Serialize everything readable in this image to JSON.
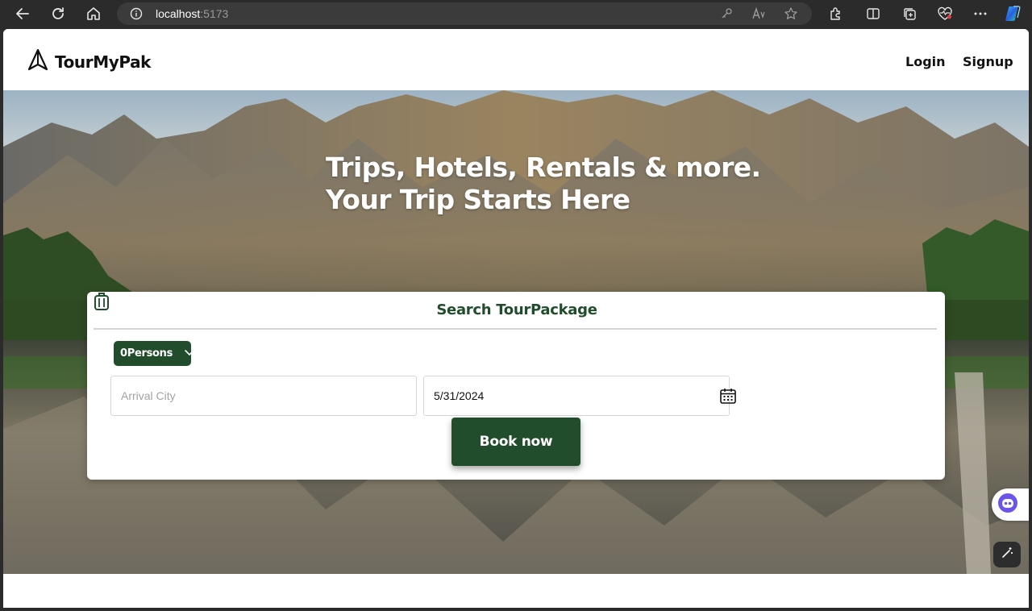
{
  "browser": {
    "url_host": "localhost",
    "url_port": ":5173"
  },
  "navbar": {
    "brand": "TourMyPak",
    "login_label": "Login",
    "signup_label": "Signup"
  },
  "hero": {
    "title_line1": "Trips, Hotels, Rentals & more.",
    "title_line2": "Your Trip Starts Here"
  },
  "search": {
    "title": "Search TourPackage",
    "persons_label": "0Persons",
    "arrival_placeholder": "Arrival City",
    "date_value": "5/31/2024",
    "book_label": "Book now"
  },
  "colors": {
    "brand_green": "#214d2c",
    "browser_bg": "#2b2b2b"
  },
  "icons": [
    "back-icon",
    "refresh-icon",
    "home-icon",
    "info-icon",
    "key-icon",
    "read-aloud-icon",
    "favorite-star-icon",
    "extensions-icon",
    "split-screen-icon",
    "collections-icon",
    "browser-essentials-icon",
    "more-icon",
    "copilot-icon",
    "logo-icon",
    "luggage-icon",
    "chevron-down-icon",
    "calendar-icon",
    "chatbot-icon",
    "magic-wand-icon"
  ]
}
